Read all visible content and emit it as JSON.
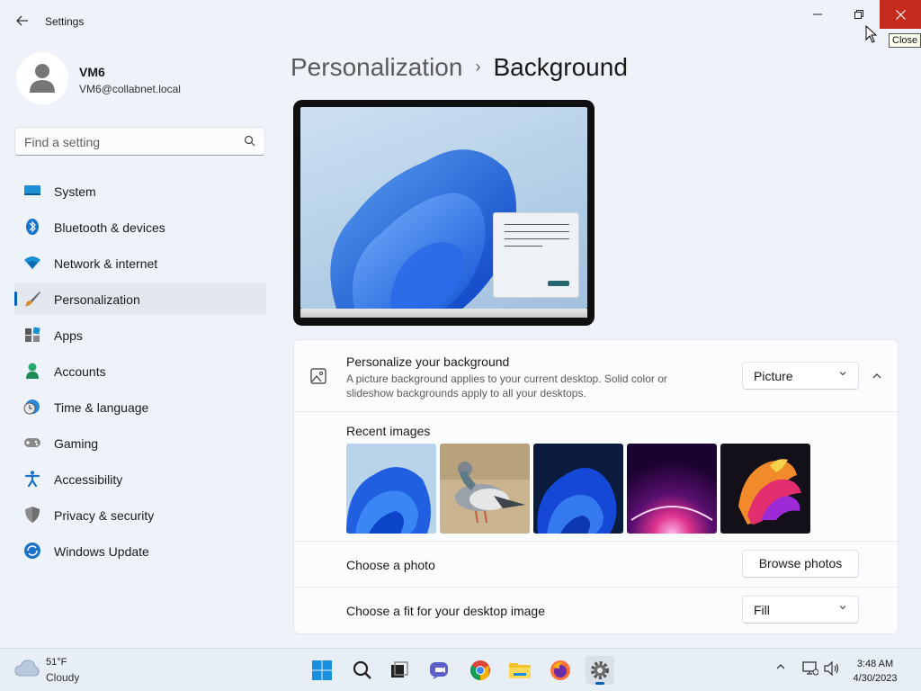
{
  "window": {
    "app_title": "Settings",
    "close_tooltip": "Close"
  },
  "profile": {
    "name": "VM6",
    "email": "VM6@collabnet.local"
  },
  "search": {
    "placeholder": "Find a setting"
  },
  "sidebar": {
    "items": [
      {
        "label": "System",
        "icon": "system-icon"
      },
      {
        "label": "Bluetooth & devices",
        "icon": "bluetooth-icon"
      },
      {
        "label": "Network & internet",
        "icon": "wifi-icon"
      },
      {
        "label": "Personalization",
        "icon": "brush-icon",
        "active": true
      },
      {
        "label": "Apps",
        "icon": "apps-icon"
      },
      {
        "label": "Accounts",
        "icon": "accounts-icon"
      },
      {
        "label": "Time & language",
        "icon": "time-language-icon"
      },
      {
        "label": "Gaming",
        "icon": "gaming-icon"
      },
      {
        "label": "Accessibility",
        "icon": "accessibility-icon"
      },
      {
        "label": "Privacy & security",
        "icon": "shield-icon"
      },
      {
        "label": "Windows Update",
        "icon": "windows-update-icon"
      }
    ]
  },
  "header": {
    "parent": "Personalization",
    "separator": "›",
    "current": "Background"
  },
  "background_settings": {
    "personalize": {
      "title": "Personalize your background",
      "description": "A picture background applies to your current desktop. Solid color or slideshow backgrounds apply to all your desktops.",
      "selected": "Picture"
    },
    "recent_images": {
      "title": "Recent images",
      "items": [
        "bloom-light",
        "pigeon",
        "bloom-dark",
        "purple-glow",
        "abstract-ribbon"
      ]
    },
    "choose_photo": {
      "title": "Choose a photo",
      "button": "Browse photos"
    },
    "fit": {
      "title": "Choose a fit for your desktop image",
      "selected": "Fill"
    }
  },
  "taskbar": {
    "weather": {
      "temp": "51°F",
      "condition": "Cloudy"
    },
    "clock": {
      "time": "3:48 AM",
      "date": "4/30/2023"
    },
    "apps": [
      "start-icon",
      "search-icon",
      "task-view-icon",
      "teams-chat-icon",
      "chrome-icon",
      "file-explorer-icon",
      "firefox-icon",
      "settings-icon"
    ]
  },
  "colors": {
    "accent": "#005fb8",
    "close_red": "#c42b1c",
    "background": "#eef3f9"
  }
}
